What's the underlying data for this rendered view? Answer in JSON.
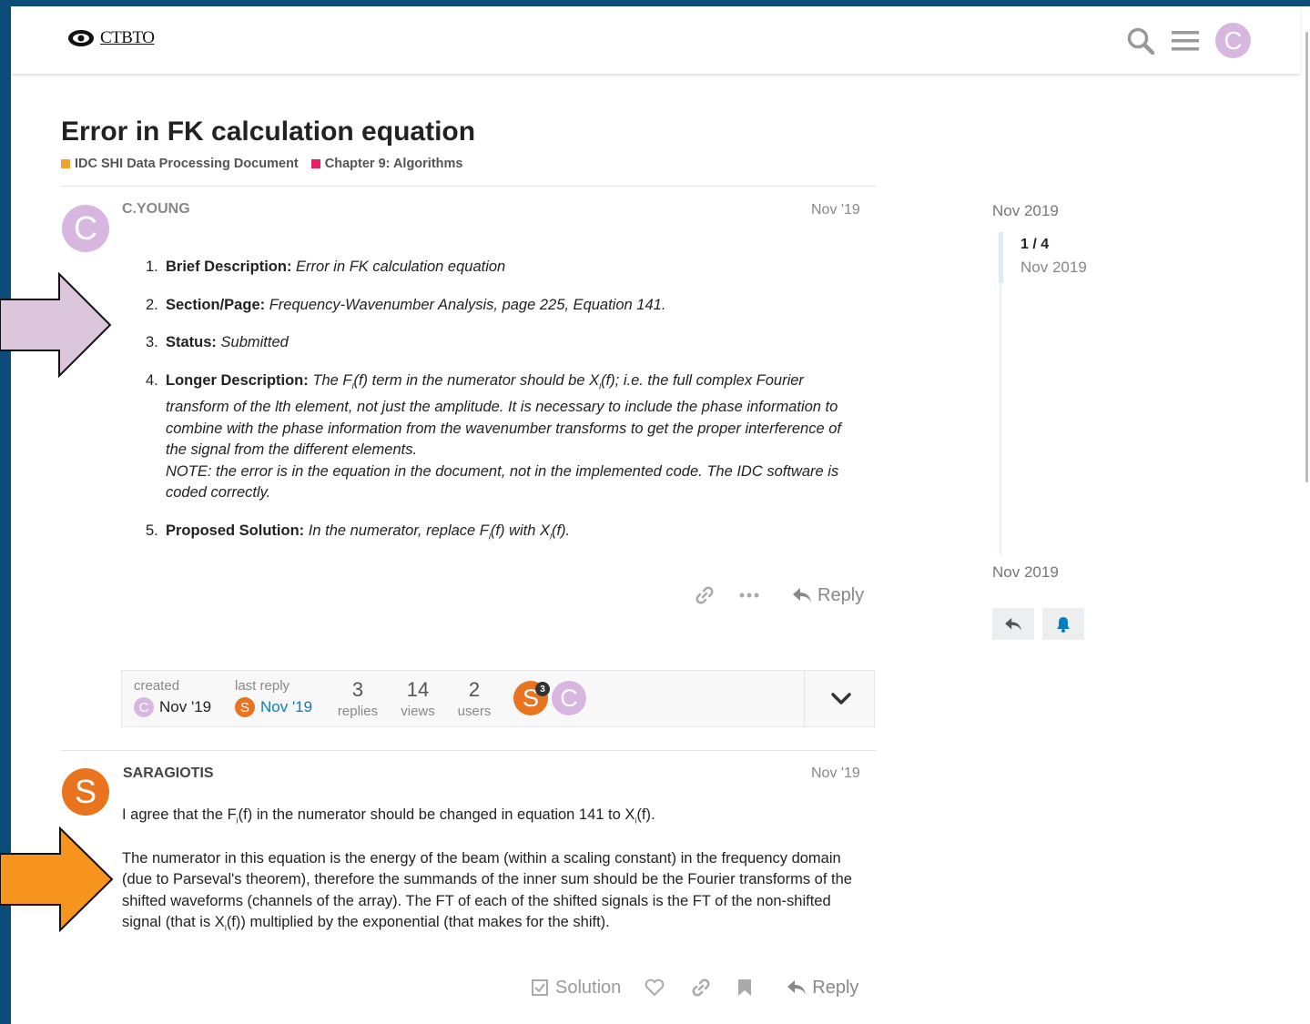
{
  "app": {
    "logo_text": "CTBTO",
    "user_initial": "C"
  },
  "topic": {
    "title": "Error in FK calculation equation",
    "categories": [
      {
        "name": "IDC SHI Data Processing Document",
        "color": "#f1a12e"
      },
      {
        "name": "Chapter 9: Algorithms",
        "color": "#e91e63"
      }
    ]
  },
  "post1": {
    "author": "C.YOUNG",
    "avatar_initial": "C",
    "date": "Nov '19",
    "items": [
      {
        "num": "1.",
        "label": "Brief Description:",
        "text": "Error in FK calculation equation"
      },
      {
        "num": "2.",
        "label": "Section/Page:",
        "text": "Frequency-Wavenumber Analysis, page 225, Equation 141."
      },
      {
        "num": "3.",
        "label": "Status:",
        "text": "Submitted"
      },
      {
        "num": "4.",
        "label": "Longer Description:",
        "text_a": "The F",
        "sub_a": "l",
        "text_b": "(f) term in the numerator should be X",
        "sub_b": "l",
        "text_c": "(f); i.e. the full complex Fourier transform of the lth element, not just the amplitude. It is necessary to include the phase information to combine with the phase information from the wavenumber transforms to get the proper interference of the signal from the different elements.",
        "note": "NOTE: the error is in the equation in the document, not in the implemented code. The IDC software is coded correctly."
      },
      {
        "num": "5.",
        "label": "Proposed Solution:",
        "text_a": "In the numerator, replace F",
        "sub_a": "l",
        "text_b": "(f) with X",
        "sub_b": "l",
        "text_c": "(f)."
      }
    ],
    "reply_label": "Reply"
  },
  "topic_map": {
    "created_label": "created",
    "created_date": "Nov '19",
    "created_initial": "C",
    "last_reply_label": "last reply",
    "last_reply_date": "Nov '19",
    "last_reply_initial": "S",
    "replies_count": "3",
    "replies_label": "replies",
    "views_count": "14",
    "views_label": "views",
    "users_count": "2",
    "users_label": "users",
    "participant_1_initial": "S",
    "participant_1_badge": "3",
    "participant_2_initial": "C"
  },
  "post2": {
    "author": "SARAGIOTIS",
    "avatar_initial": "S",
    "date": "Nov '19",
    "p1_a": "I agree that the F",
    "p1_sub_a": "i",
    "p1_b": "(f) in the numerator should be changed in equation 141 to X",
    "p1_sub_b": "i",
    "p1_c": "(f).",
    "p2_a": "The numerator in this equation is the energy of the beam (within a scaling constant) in the frequency domain (due to Parseval's theorem), therefore the summands of the inner sum should be the Fourier transforms of the shifted waveforms (channels of the array). The FT of each of the shifted signals is the FT of the non-shifted signal (that is X",
    "p2_sub": "i",
    "p2_b": "(f)) multiplied by the exponential (that makes for the shift).",
    "solution_label": "Solution",
    "reply_label": "Reply"
  },
  "timeline": {
    "top_date": "Nov 2019",
    "count": "1 / 4",
    "current_date": "Nov 2019",
    "bottom_date": "Nov 2019"
  },
  "colors": {
    "frame": "#0b4d78",
    "arrow_purple": "#dcc6de",
    "arrow_orange": "#f7941d",
    "link_blue": "#0a7cc1"
  }
}
